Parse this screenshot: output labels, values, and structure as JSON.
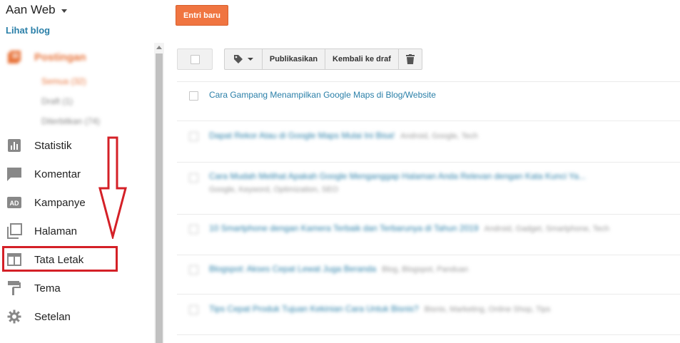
{
  "header": {
    "blog_name": "Aan Web",
    "view_blog": "Lihat blog"
  },
  "sidebar": {
    "posts": {
      "label": "Postingan",
      "icon": "posts-icon"
    },
    "post_subitems": [
      "Semua (32)",
      "Draft (1)",
      "Diterbitkan (74)"
    ],
    "items": [
      {
        "label": "Statistik",
        "icon": "stats-icon"
      },
      {
        "label": "Komentar",
        "icon": "comment-icon"
      },
      {
        "label": "Kampanye",
        "icon": "ad-icon"
      },
      {
        "label": "Halaman",
        "icon": "pages-icon"
      },
      {
        "label": "Tata Letak",
        "icon": "layout-icon"
      },
      {
        "label": "Tema",
        "icon": "paint-roller-icon"
      },
      {
        "label": "Setelan",
        "icon": "gear-icon"
      }
    ]
  },
  "toolbar": {
    "new_post": "Entri baru",
    "publish": "Publikasikan",
    "revert_draft": "Kembali ke draf"
  },
  "posts": [
    {
      "title": "Cara Gampang Menampilkan Google Maps di Blog/Website",
      "labels": ""
    },
    {
      "title": "Dapat Rekor Atau di Google Maps Mulai Ini Bisa!",
      "labels": "Android, Google, Tech"
    },
    {
      "title": "Cara Mudah Melihat Apakah Google Menganggap Halaman Anda Relevan dengan Kata Kunci Ya...",
      "labels": "Google, Keyword, Optimization, SEO"
    },
    {
      "title": "10 Smartphone dengan Kamera Terbaik dan Terbarunya di Tahun 2019",
      "labels": "Android, Gadget, Smartphone, Tech"
    },
    {
      "title": "Blogspot: Akses Cepat Lewat Juga Beranda",
      "labels": "Blog, Blogspot, Panduan"
    },
    {
      "title": "Tips Cepat Produk Tujuan Kekinian Cara Untuk Bisnis?",
      "labels": "Bisnis, Marketing, Online Shop, Tips"
    }
  ],
  "colors": {
    "accent": "#f07541",
    "link": "#2a7fa8",
    "annotation": "#d42027"
  }
}
